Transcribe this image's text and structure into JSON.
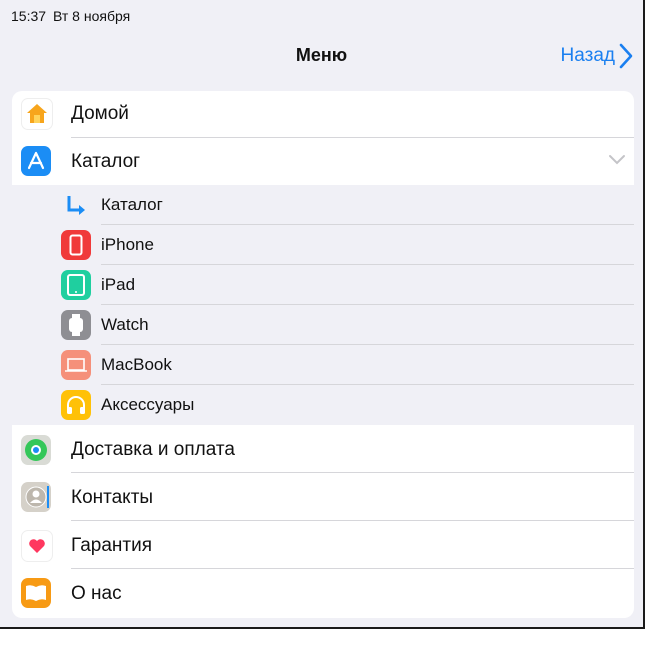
{
  "status": {
    "time": "15:37",
    "date": "Вт 8 ноября"
  },
  "nav": {
    "title": "Меню",
    "back_label": "Назад"
  },
  "menu": {
    "home": "Домой",
    "catalog": "Каталог",
    "catalog_sub": [
      {
        "label": "Каталог",
        "icon": "return-arrow-icon"
      },
      {
        "label": "iPhone",
        "icon": "iphone-icon"
      },
      {
        "label": "iPad",
        "icon": "ipad-icon"
      },
      {
        "label": "Watch",
        "icon": "watch-icon"
      },
      {
        "label": "MacBook",
        "icon": "macbook-icon"
      },
      {
        "label": "Аксессуары",
        "icon": "headphones-icon"
      }
    ],
    "delivery": "Доставка и оплата",
    "contacts": "Контакты",
    "warranty": "Гарантия",
    "about": "О нас"
  },
  "colors": {
    "accent": "#1a7ff0",
    "home": "#ffffff",
    "catalog": "#1b8df5",
    "iphone": "#f03a3a",
    "ipad": "#1fcf9f",
    "watch": "#8e8e93",
    "macbook": "#f5907a",
    "accessories": "#ffc107",
    "delivery": "#d9dbd5",
    "contacts": "#d5d1c9",
    "warranty": "#ffffff",
    "about": "#f79a14"
  }
}
